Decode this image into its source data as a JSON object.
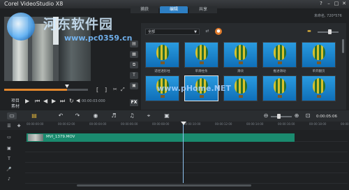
{
  "window": {
    "title": "Corel VideoStudio X8",
    "controls": [
      "?",
      "–",
      "□",
      "✕"
    ]
  },
  "tabs": [
    {
      "label": "捕获",
      "active": false
    },
    {
      "label": "编辑",
      "active": true
    },
    {
      "label": "共享",
      "active": false
    }
  ],
  "resolution": "未命名, 720*576",
  "watermark": {
    "title": "河东软件园",
    "url": "www.pc0359.cn",
    "center_text": "www.pHome.NET"
  },
  "player": {
    "project_label": "项目",
    "clip_label": "素材",
    "timecode": "00:00:03:000",
    "scrub_progress": 0.75
  },
  "library": {
    "category": "全部",
    "thumbnails": [
      {
        "label": "适径透形柱",
        "selected": false
      },
      {
        "label": "单滑柱条",
        "selected": false
      },
      {
        "label": "滑块",
        "selected": false
      },
      {
        "label": "推进滑动",
        "selected": false
      },
      {
        "label": "单开翻页",
        "selected": false
      },
      {
        "label": "",
        "selected": false
      },
      {
        "label": "",
        "selected": true
      },
      {
        "label": "",
        "selected": false
      },
      {
        "label": "",
        "selected": false
      },
      {
        "label": "",
        "selected": false
      }
    ]
  },
  "timeline": {
    "timecode": "0:00:05:06",
    "ruler_labels": [
      "00:00:00:00",
      "00:00:02:00",
      "00:00:04:00",
      "00:00:06:00",
      "00:00:08:00",
      "00:00:10:00",
      "00:00:12:00",
      "00:00:14:00",
      "00:00:16:00",
      "00:00:18:00",
      "00:00:20:00"
    ],
    "clip_name": "MVI_1379.MOV"
  },
  "colors": {
    "accent": "#2d7fc4",
    "clip": "#1a8a6e",
    "scrub": "#e1862c"
  }
}
